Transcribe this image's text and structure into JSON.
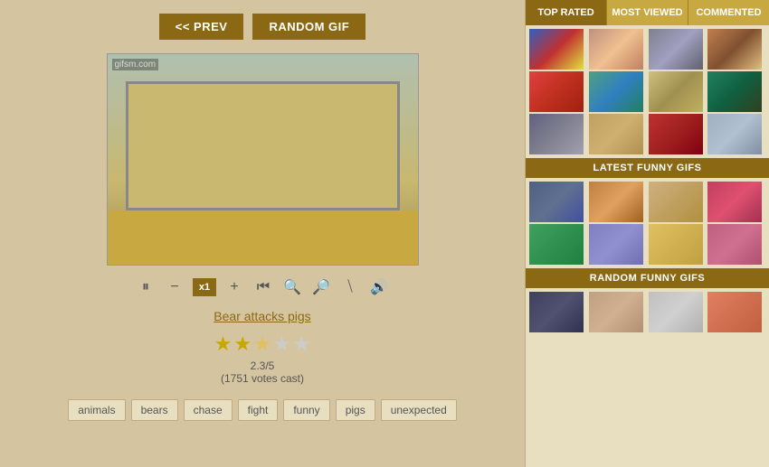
{
  "nav": {
    "prev_label": "<< PREV",
    "random_label": "RANDOM GIF"
  },
  "watermark": "gifsm.com",
  "gif_title": "Bear attacks pigs",
  "rating": {
    "value": "2.3/5",
    "votes": "(1751 votes cast)",
    "stars": [
      true,
      true,
      false,
      false,
      false
    ]
  },
  "controls": {
    "pause": "⏸",
    "minus": "−",
    "x1": "x1",
    "plus": "+",
    "rewind": "⏮",
    "zoom_out": "🔍",
    "zoom_in": "🔎",
    "expand": "⛶",
    "sound": "🔊"
  },
  "tags": [
    "animals",
    "bears",
    "chase",
    "fight",
    "funny",
    "pigs",
    "unexpected"
  ],
  "right_panel": {
    "tabs": [
      "TOP RATED",
      "MOST VIEWED",
      "COMMENTED"
    ],
    "active_tab": 0,
    "sections": [
      {
        "label": "LATEST FUNNY GIFS"
      },
      {
        "label": "RANDOM FUNNY GIFS"
      }
    ]
  }
}
